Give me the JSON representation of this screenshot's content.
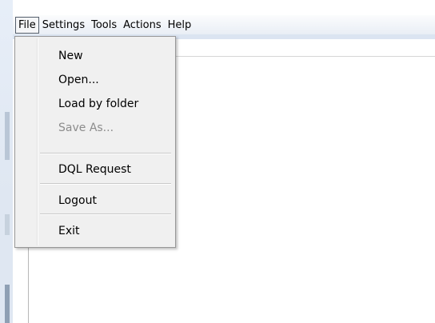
{
  "menubar": {
    "items": [
      "File",
      "Settings",
      "Tools",
      "Actions",
      "Help"
    ]
  },
  "file_menu": {
    "items": [
      {
        "label": "New",
        "enabled": true
      },
      {
        "label": "Open...",
        "enabled": true
      },
      {
        "label": "Load by folder",
        "enabled": true
      },
      {
        "label": "Save As...",
        "enabled": false
      },
      {
        "label": "DQL Request",
        "enabled": true
      },
      {
        "label": "Logout",
        "enabled": true
      },
      {
        "label": "Exit",
        "enabled": true
      }
    ]
  },
  "colors": {
    "menu_background": "#f0f0f0",
    "disabled_text": "#8c8c8c",
    "menubar_background": "#e9eef5"
  }
}
